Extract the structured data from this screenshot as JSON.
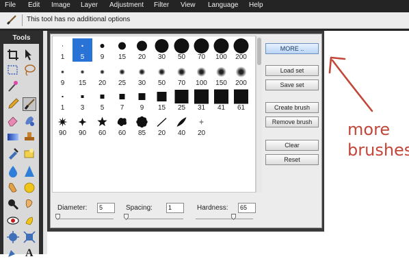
{
  "menu": [
    "File",
    "Edit",
    "Image",
    "Layer",
    "Adjustment",
    "Filter",
    "View",
    "Language",
    "Help"
  ],
  "options_bar": {
    "message": "This tool has no additional options",
    "tool_icon": "brush-icon"
  },
  "tools_panel": {
    "title": "Tools",
    "tools": [
      "crop-icon",
      "move-icon",
      "marquee-icon",
      "lasso-icon",
      "wand-icon",
      "pencil-icon",
      "brush-icon",
      "eraser-icon",
      "replace-color-icon",
      "gradient-icon",
      "stamp-icon",
      "color-picker-icon",
      "type-mask-icon",
      "blur-icon",
      "sharpen-icon",
      "smudge-icon",
      "sponge-icon",
      "zoom-icon",
      "dodge-icon",
      "red-eye-icon",
      "burn-icon",
      "bloat-icon",
      "pinch-icon",
      "pen-icon",
      "type-icon"
    ],
    "selected": "brush-icon"
  },
  "brushes": {
    "rows": [
      [
        "1",
        "5",
        "9",
        "15",
        "20",
        "30",
        "50",
        "70",
        "100",
        "200"
      ],
      [
        "9",
        "15",
        "20",
        "25",
        "30",
        "50",
        "70",
        "100",
        "150",
        "200"
      ],
      [
        "1",
        "3",
        "5",
        "7",
        "9",
        "15",
        "25",
        "31",
        "41",
        "61"
      ],
      [
        "90",
        "90",
        "60",
        "60",
        "85",
        "20",
        "40",
        "20"
      ]
    ],
    "selected": "5"
  },
  "buttons": {
    "more": "MORE ..",
    "load_set": "Load set",
    "save_set": "Save set",
    "create_brush": "Create brush",
    "remove_brush": "Remove brush",
    "clear": "Clear",
    "reset": "Reset"
  },
  "sliders": {
    "diameter": {
      "label": "Diameter:",
      "value": "5",
      "level": 0.02
    },
    "spacing": {
      "label": "Spacing:",
      "value": "1",
      "level": 0.0
    },
    "hardness": {
      "label": "Hardness:",
      "value": "65",
      "level": 0.65
    }
  },
  "annotation": {
    "line1": "more",
    "line2": "brushes",
    "color": "#c2473a"
  },
  "colors": {
    "selection": "#2a73d6",
    "menubar": "#242424",
    "panel_frame": "#3a3a3a"
  }
}
